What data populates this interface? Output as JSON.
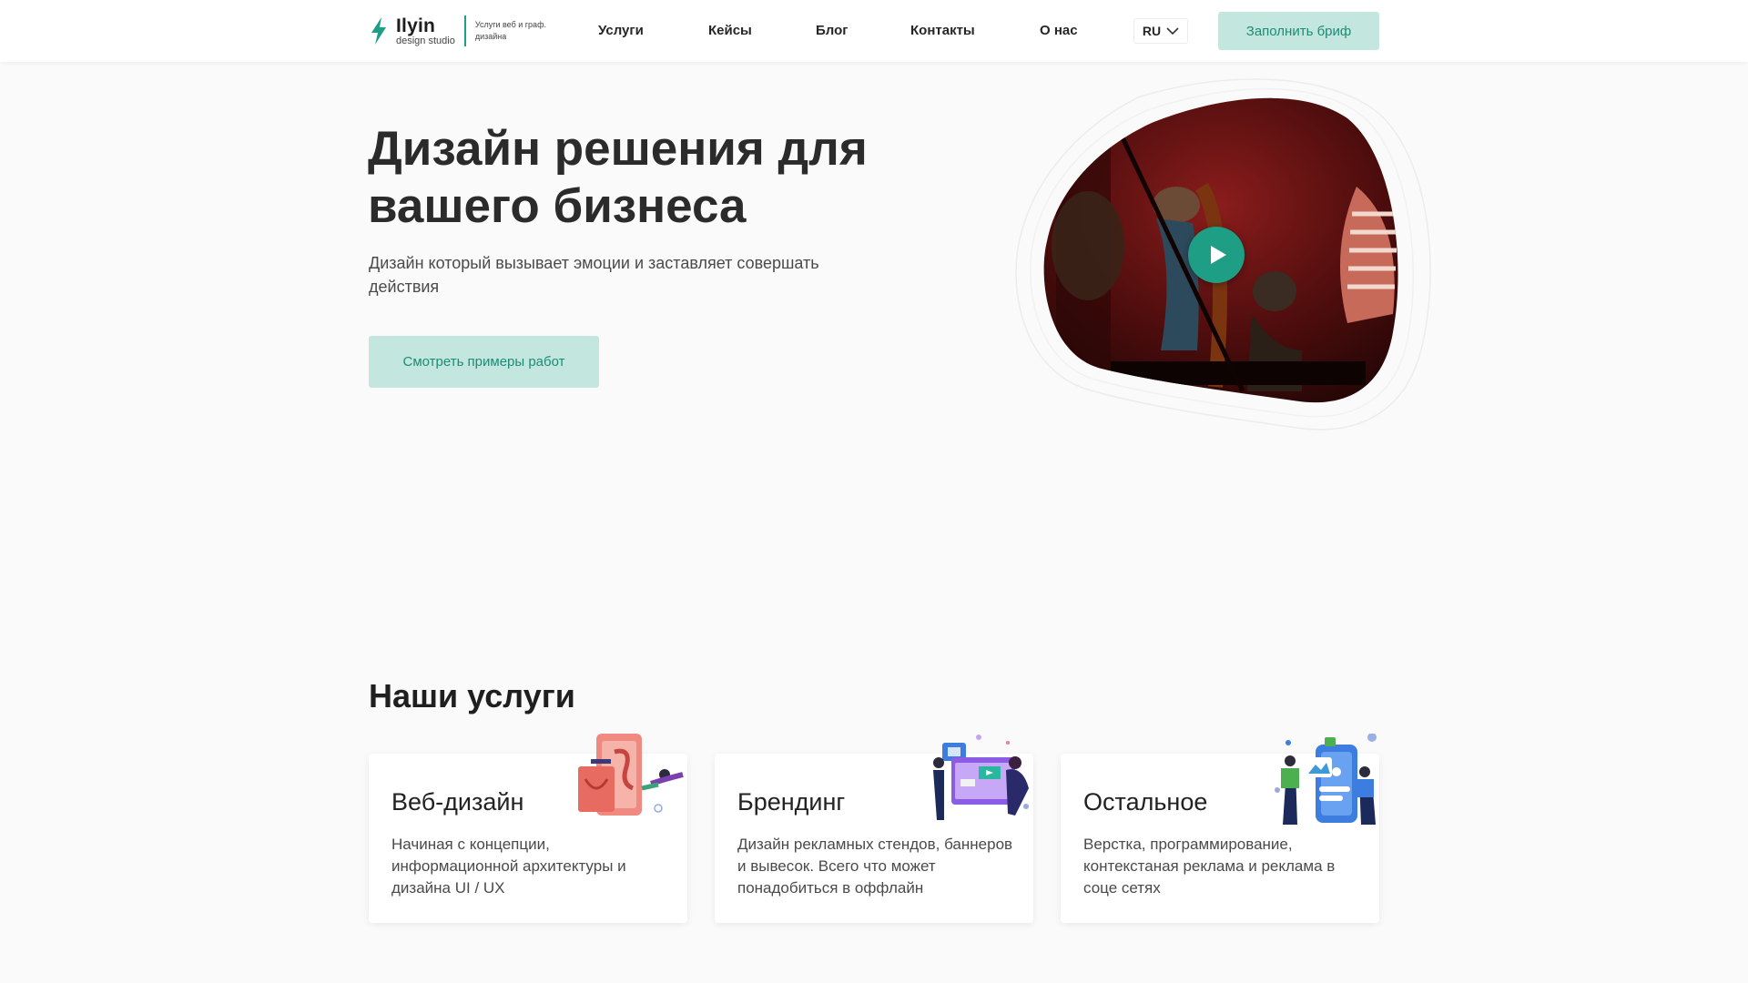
{
  "header": {
    "logo": {
      "name": "Ilyin",
      "subtitle": "design studio",
      "tagline": "Услуги веб и граф. дизайна",
      "accent_color": "#1f9e86"
    },
    "nav": [
      {
        "label": "Услуги"
      },
      {
        "label": "Кейсы"
      },
      {
        "label": "Блог"
      },
      {
        "label": "Контакты"
      },
      {
        "label": "О нас"
      }
    ],
    "language": {
      "value": "RU",
      "icon": "chevron-down-icon"
    },
    "brief_button": "Заполнить бриф"
  },
  "hero": {
    "title": "Дизайн решения для вашего бизнеса",
    "subtitle": "Дизайн который вызывает эмоции и заставляет совершать действия",
    "cta_button": "Смотреть примеры работ",
    "video": {
      "play_icon": "play-icon",
      "button_color": "#1f9e86"
    }
  },
  "services": {
    "title": "Наши услуги",
    "cards": [
      {
        "title": "Веб-дизайн",
        "description": "Начиная с концепции, информационной архитектуры и дизайна UI / UX",
        "illustration": "web-design-illustration"
      },
      {
        "title": "Брендинг",
        "description": "Дизайн рекламных стендов, баннеров и вывесок. Всего что может понадобиться в оффлайн",
        "illustration": "branding-illustration"
      },
      {
        "title": "Остальное",
        "description": "Верстка, программирование, контекстаная реклама и реклама в соце сетях",
        "illustration": "other-services-illustration"
      }
    ]
  },
  "colors": {
    "accent": "#1f9e86",
    "button_bg": "#c3e6df",
    "page_bg": "#fafafa"
  }
}
